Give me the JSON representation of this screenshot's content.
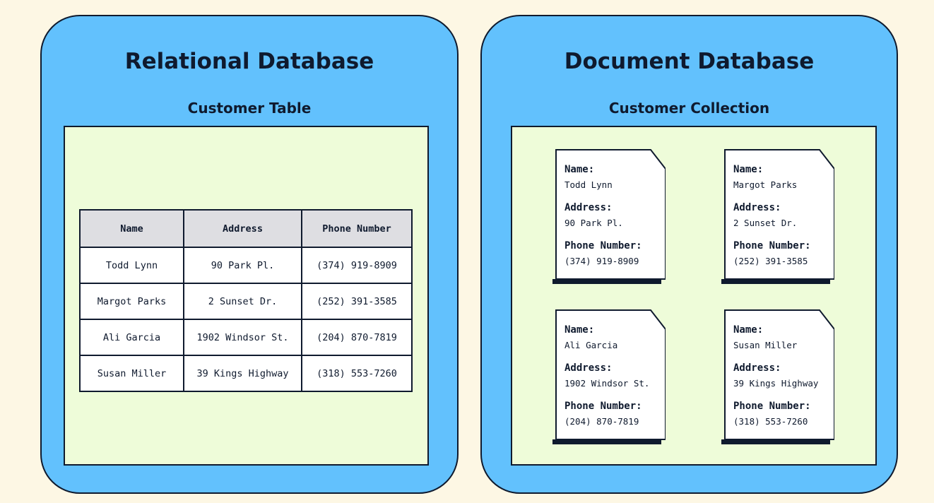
{
  "relational": {
    "title": "Relational Database",
    "subtitle": "Customer Table",
    "columns": [
      "Name",
      "Address",
      "Phone Number"
    ],
    "rows": [
      [
        "Todd Lynn",
        "90 Park Pl.",
        "(374) 919-8909"
      ],
      [
        "Margot Parks",
        "2 Sunset Dr.",
        "(252) 391-3585"
      ],
      [
        "Ali Garcia",
        "1902 Windsor St.",
        "(204) 870-7819"
      ],
      [
        "Susan Miller",
        "39 Kings Highway",
        "(318) 553-7260"
      ]
    ]
  },
  "document": {
    "title": "Document Database",
    "subtitle": "Customer Collection",
    "field_labels": {
      "name": "Name:",
      "address": "Address:",
      "phone": "Phone Number:"
    },
    "docs": [
      {
        "name": "Todd Lynn",
        "address": "90 Park Pl.",
        "phone": "(374) 919-8909"
      },
      {
        "name": "Margot Parks",
        "address": "2 Sunset Dr.",
        "phone": "(252) 391-3585"
      },
      {
        "name": "Ali Garcia",
        "address": "1902 Windsor St.",
        "phone": "(204) 870-7819"
      },
      {
        "name": "Susan Miller",
        "address": "39 Kings Highway",
        "phone": "(318) 553-7260"
      }
    ]
  },
  "colors": {
    "background": "#fdf7e4",
    "panel": "#62c1fd",
    "inner": "#eefcd9",
    "outline": "#0f1a2e",
    "header_cell": "#dedee2"
  }
}
